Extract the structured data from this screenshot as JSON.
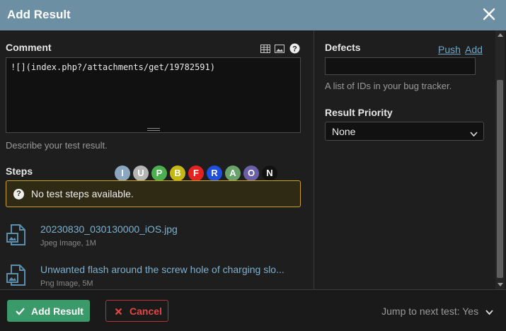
{
  "dialog": {
    "title": "Add Result"
  },
  "comment": {
    "label": "Comment",
    "value": "![](index.php?/attachments/get/19782591)",
    "hint": "Describe your test result.",
    "toolbar_icons": [
      "table-icon",
      "image-icon",
      "help-icon"
    ]
  },
  "steps": {
    "label": "Steps",
    "statuses": [
      {
        "letter": "I",
        "color": "#8aa6c1"
      },
      {
        "letter": "U",
        "color": "#b5b5b5"
      },
      {
        "letter": "P",
        "color": "#4caf50"
      },
      {
        "letter": "B",
        "color": "#c6b814"
      },
      {
        "letter": "F",
        "color": "#e52222"
      },
      {
        "letter": "R",
        "color": "#1f4fe0"
      },
      {
        "letter": "A",
        "color": "#6aa36a"
      },
      {
        "letter": "O",
        "color": "#6a5fa8"
      },
      {
        "letter": "N",
        "color": "#111111"
      }
    ],
    "notice": "No test steps available."
  },
  "attachments": [
    {
      "name": "20230830_030130000_iOS.jpg",
      "meta": "Jpeg Image, 1M"
    },
    {
      "name": "Unwanted flash around the screw hole of charging slo...",
      "meta": "Png Image, 5M"
    }
  ],
  "defects": {
    "label": "Defects",
    "push_link": "Push",
    "add_link": "Add",
    "value": "",
    "hint": "A list of IDs in your bug tracker."
  },
  "priority": {
    "label": "Result Priority",
    "selected": "None"
  },
  "footer": {
    "add_label": "Add Result",
    "cancel_label": "Cancel",
    "jump_label": "Jump to next test: Yes"
  },
  "colors": {
    "titlebar": "#6c8fa3",
    "add_button": "#3a9a6a",
    "cancel": "#e04848",
    "link": "#7eb1cf",
    "notice_border": "#c9a227"
  }
}
